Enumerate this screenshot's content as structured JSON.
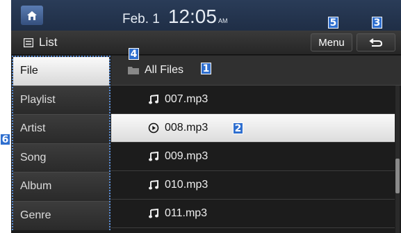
{
  "topbar": {
    "date": "Feb. 1",
    "time": "12:05",
    "ampm": "AM"
  },
  "subbar": {
    "title": "List",
    "menu_label": "Menu"
  },
  "sidebar": {
    "items": [
      {
        "label": "File",
        "selected": true
      },
      {
        "label": "Playlist"
      },
      {
        "label": "Artist"
      },
      {
        "label": "Song"
      },
      {
        "label": "Album"
      },
      {
        "label": "Genre"
      }
    ]
  },
  "folder": {
    "label": "All Files"
  },
  "files": [
    {
      "name": "007.mp3",
      "icon": "music-note-icon"
    },
    {
      "name": "008.mp3",
      "icon": "play-circle-icon",
      "playing": true
    },
    {
      "name": "009.mp3",
      "icon": "music-note-icon"
    },
    {
      "name": "010.mp3",
      "icon": "music-note-icon"
    },
    {
      "name": "011.mp3",
      "icon": "music-note-icon"
    }
  ],
  "callouts": {
    "c1": "1",
    "c2": "2",
    "c3": "3",
    "c4": "4",
    "c5": "5",
    "c6": "6"
  },
  "colors": {
    "callout": "#2f6fcf",
    "topbar": "#23344f",
    "selection": "#e8e8e8"
  }
}
